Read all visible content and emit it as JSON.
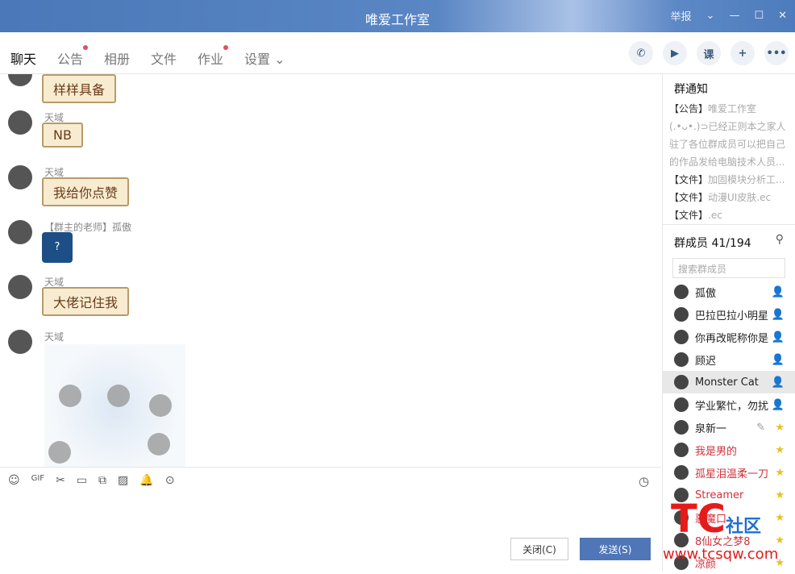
{
  "window": {
    "title": "唯爱工作室",
    "report": "举报"
  },
  "tabs": [
    {
      "label": "聊天",
      "active": true
    },
    {
      "label": "公告",
      "dot": true
    },
    {
      "label": "相册"
    },
    {
      "label": "文件"
    },
    {
      "label": "作业",
      "dot": true
    },
    {
      "label": "设置 ⌄"
    }
  ],
  "actions": [
    {
      "icon": "phone-icon",
      "glyph": "✆"
    },
    {
      "icon": "video-icon",
      "glyph": "▶"
    },
    {
      "icon": "class-icon",
      "glyph": "课"
    },
    {
      "icon": "add-app-icon",
      "glyph": "+"
    },
    {
      "icon": "more-icon",
      "glyph": "•••"
    }
  ],
  "messages": [
    {
      "sender": "",
      "text": "样样具备"
    },
    {
      "sender": "天域",
      "text": "NB"
    },
    {
      "sender": "天域",
      "text": "我给你点赞"
    },
    {
      "sender": "【群主的老师】孤傲",
      "text": "?",
      "image": true
    },
    {
      "sender": "天域",
      "text": "大佬记住我"
    },
    {
      "sender": "天域",
      "text": "",
      "bigimage": true
    }
  ],
  "toolbar": [
    {
      "icon": "emoji-icon",
      "glyph": "☺"
    },
    {
      "icon": "gif-icon",
      "glyph": "GIF"
    },
    {
      "icon": "scissors-icon",
      "glyph": "✂"
    },
    {
      "icon": "folder-icon",
      "glyph": "▭"
    },
    {
      "icon": "screenshot-icon",
      "glyph": "⧉"
    },
    {
      "icon": "image-icon",
      "glyph": "▨"
    },
    {
      "icon": "bell-icon",
      "glyph": "🔔"
    },
    {
      "icon": "more-icon",
      "glyph": "⊙"
    }
  ],
  "history_icon": "clock-icon",
  "buttons": {
    "close": "关闭(C)",
    "send": "发送(S)"
  },
  "notice": {
    "title": "群通知",
    "items": [
      {
        "tag": "【公告】",
        "text": "唯爱工作室(.•ᴗ•.)⊃已经正则本之家人驻了各位群成员可以把自己的作品发给电脑技术人员..."
      },
      {
        "tag": "【文件】",
        "text": "加固模块分析工..."
      },
      {
        "tag": "【文件】",
        "text": "动漫UI皮肤.ec"
      },
      {
        "tag": "【文件】",
        "text": ".ec"
      }
    ]
  },
  "members": {
    "title": "群成员 41/194",
    "search_placeholder": "搜索群成员",
    "list": [
      {
        "name": "孤傲",
        "role": "admin"
      },
      {
        "name": "巴拉巴拉小明星",
        "role": "admin"
      },
      {
        "name": "你再改昵称你是",
        "role": "admin"
      },
      {
        "name": "顾迟",
        "role": "admin"
      },
      {
        "name": "Monster Cat",
        "role": "admin",
        "selected": true
      },
      {
        "name": "学业繁忙，勿扰",
        "role": "admin"
      },
      {
        "name": "泉新一",
        "role": "star",
        "edit": true
      },
      {
        "name": "我是男的",
        "role": "star",
        "red": true
      },
      {
        "name": "孤星泪温柔一刀",
        "role": "star",
        "red": true
      },
      {
        "name": "Streamer",
        "role": "star",
        "red": true
      },
      {
        "name": "惡魔口",
        "role": "star",
        "red": true
      },
      {
        "name": "8仙女之梦8",
        "role": "star",
        "red": true
      },
      {
        "name": "凉颜",
        "role": "star",
        "red": true
      }
    ]
  },
  "watermark": {
    "brand": "TC社区",
    "url": "www.tcsqw.com"
  },
  "colors": {
    "titlebar": "#4a78b8",
    "send": "#4f76b6",
    "member_red": "#d0323c"
  }
}
